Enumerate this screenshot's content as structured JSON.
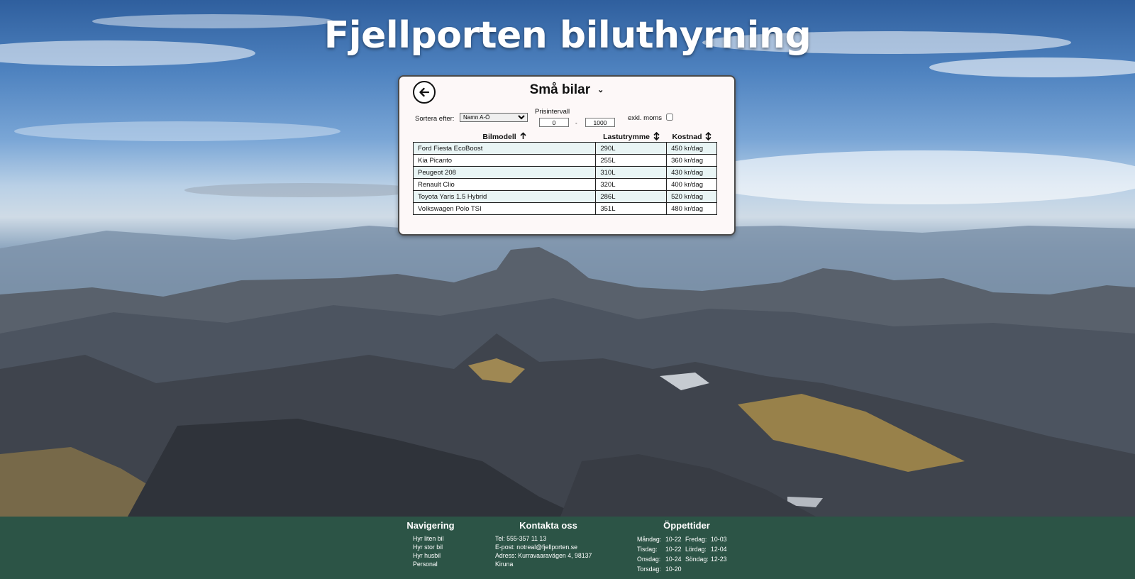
{
  "site": {
    "title": "Fjellporten biluthyrning",
    "background_image": "mountain-landscape"
  },
  "panel": {
    "back_icon": "arrow-left-icon",
    "category": "Små bilar",
    "category_chevron_icon": "chevron-down-icon"
  },
  "controls": {
    "sort_label": "Sortera efter:",
    "sort_selected": "Namn A-Ö",
    "price_label": "Prisintervall",
    "price_min": "0",
    "price_max": "1000",
    "price_separator": "-",
    "vat_label": "exkl. moms",
    "vat_checked": false
  },
  "table": {
    "headers": [
      {
        "label": "Bilmodell",
        "sort_icon": "arrow-up-icon"
      },
      {
        "label": "Lastutrymme",
        "sort_icon": "arrow-up-down-icon"
      },
      {
        "label": "Kostnad",
        "sort_icon": "arrow-up-down-icon"
      }
    ],
    "rows": [
      {
        "model": "Ford Fiesta EcoBoost",
        "cargo": "290L",
        "cost": "450 kr/dag"
      },
      {
        "model": "Kia Picanto",
        "cargo": "255L",
        "cost": "360 kr/dag"
      },
      {
        "model": "Peugeot 208",
        "cargo": "310L",
        "cost": "430 kr/dag"
      },
      {
        "model": "Renault Clio",
        "cargo": "320L",
        "cost": "400 kr/dag"
      },
      {
        "model": "Toyota Yaris 1.5 Hybrid",
        "cargo": "286L",
        "cost": "520 kr/dag"
      },
      {
        "model": "Volkswagen Polo TSI",
        "cargo": "351L",
        "cost": "480 kr/dag"
      }
    ]
  },
  "footer": {
    "nav": {
      "heading": "Navigering",
      "items": [
        "Hyr liten bil",
        "Hyr stor bil",
        "Hyr husbil",
        "Personal"
      ]
    },
    "contact": {
      "heading": "Kontakta oss",
      "lines": [
        "Tel: 555-357 11 13",
        "E-post: notreal@fjellporten.se",
        "Adress: Kurravaaravägen 4, 98137",
        "Kiruna"
      ]
    },
    "hours": {
      "heading": "Öppettider",
      "days": [
        {
          "day": "Måndag:",
          "time": "10-22"
        },
        {
          "day": "Fredag:",
          "time": "10-03"
        },
        {
          "day": "Tisdag:",
          "time": "10-22"
        },
        {
          "day": "Lördag:",
          "time": "12-04"
        },
        {
          "day": "Onsdag:",
          "time": "10-24"
        },
        {
          "day": "Söndag:",
          "time": "12-23"
        },
        {
          "day": "Torsdag:",
          "time": "10-20"
        }
      ]
    }
  },
  "colors": {
    "footer_bg": "#2c5446",
    "panel_bg": "#fdf8f8",
    "row_alt": "#e9f5f5"
  }
}
